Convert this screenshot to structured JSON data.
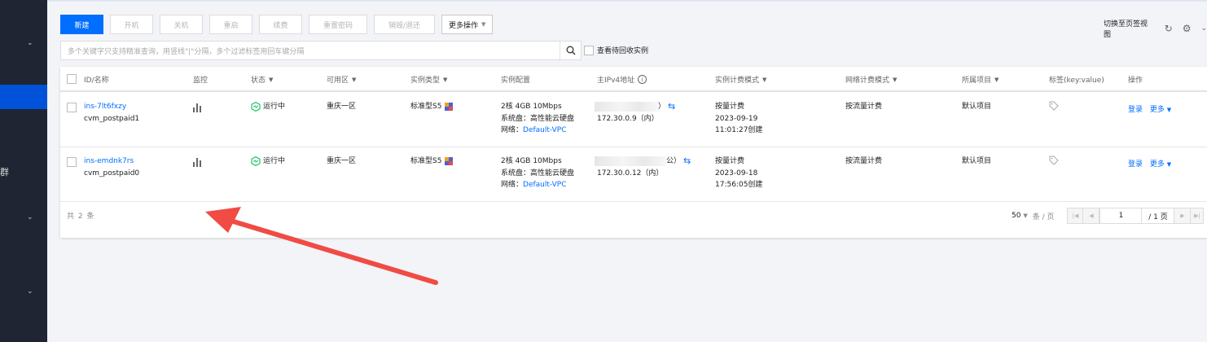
{
  "sidebar": {
    "group_label": "群"
  },
  "toolbar": {
    "new": "新建",
    "power_on": "开机",
    "power_off": "关机",
    "restart": "重启",
    "renew": "续费",
    "reset_password": "重置密码",
    "terminate": "销毁/退还",
    "more_actions": "更多操作"
  },
  "top_right": {
    "switch_view": "切换至页签视图"
  },
  "search": {
    "placeholder": "多个关键字只支持精准查询，用竖线\"|\"分隔，多个过滤标签用回车键分隔"
  },
  "recycle_label": "查看待回收实例",
  "table": {
    "headers": {
      "id_name": "ID/名称",
      "monitor": "监控",
      "status": "状态",
      "zone": "可用区",
      "instance_type": "实例类型",
      "config": "实例配置",
      "ipv4": "主IPv4地址",
      "billing": "实例计费模式",
      "net_billing": "网络计费模式",
      "project": "所属项目",
      "tags": "标签(key:value)",
      "ops": "操作"
    },
    "rows": [
      {
        "id": "ins-7lt6fxzy",
        "name": "cvm_postpaid1",
        "status": "运行中",
        "zone": "重庆一区",
        "type": "标准型S5",
        "config_line1": "2核 4GB 10Mbps",
        "config_line2": "系统盘：高性能云硬盘",
        "network_label": "网络：",
        "network_value": "Default-VPC",
        "public_suffix": "）",
        "private_ip": "172.30.0.9（内）",
        "billing": "按量计费",
        "created_date": "2023-09-19",
        "created_time": "11:01:27创建",
        "net_billing": "按流量计费",
        "project": "默认项目",
        "login": "登录",
        "more": "更多"
      },
      {
        "id": "ins-emdnk7rs",
        "name": "cvm_postpaid0",
        "status": "运行中",
        "zone": "重庆一区",
        "type": "标准型S5",
        "config_line1": "2核 4GB 10Mbps",
        "config_line2": "系统盘：高性能云硬盘",
        "network_label": "网络：",
        "network_value": "Default-VPC",
        "public_suffix": "公）",
        "private_ip": "172.30.0.12（内）",
        "billing": "按量计费",
        "created_date": "2023-09-18",
        "created_time": "17:56:05创建",
        "net_billing": "按流量计费",
        "project": "默认项目",
        "login": "登录",
        "more": "更多"
      }
    ]
  },
  "footer": {
    "total": "共 2 条",
    "page_size": "50",
    "per_page": "条 / 页",
    "current_page": "1",
    "page_total": "/ 1 页"
  },
  "colors": {
    "primary": "#006eff",
    "sidebar": "#1f2532",
    "annotation_arrow": "#f04b44"
  }
}
